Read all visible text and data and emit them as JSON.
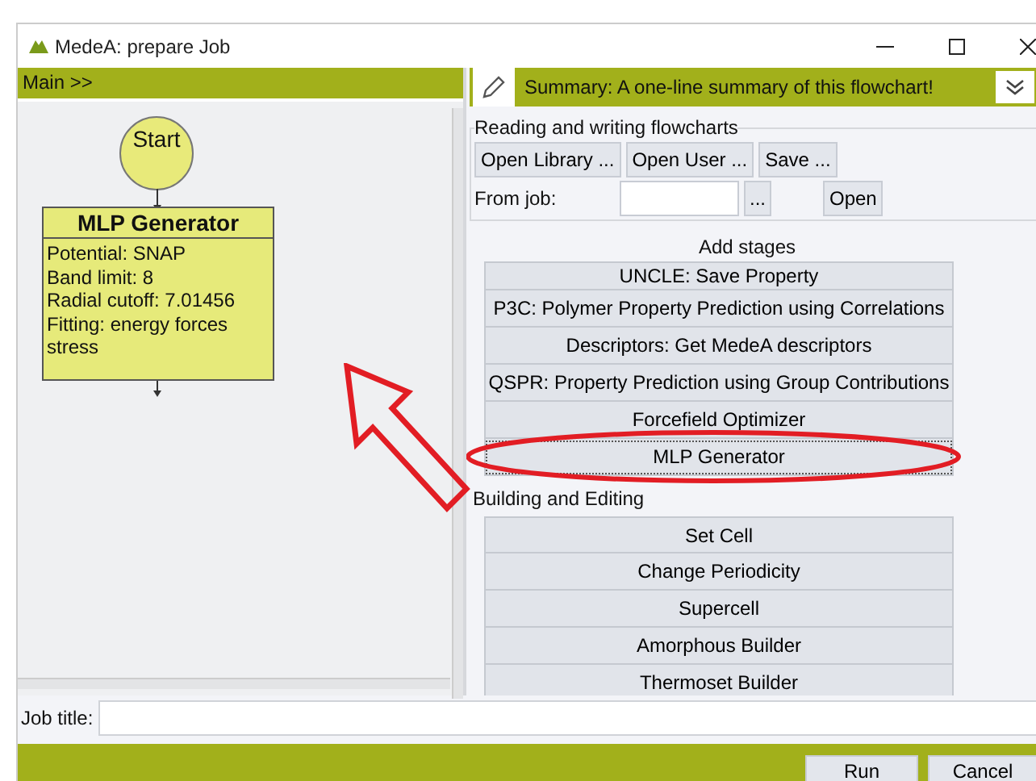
{
  "window": {
    "title": "MedeA: prepare Job"
  },
  "left_panel": {
    "header": "Main >>",
    "flowchart": {
      "start": "Start",
      "stage": {
        "title": "MLP Generator",
        "lines": [
          "Potential: SNAP",
          "Band limit: 8",
          "Radial cutoff: 7.01456",
          "Fitting: energy forces stress"
        ]
      }
    }
  },
  "summary": "Summary: A one-line summary of this flowchart!",
  "reading_group": {
    "title": "Reading and writing flowcharts",
    "buttons": [
      "Open Library ...",
      "Open User ...",
      "Save ..."
    ],
    "from_job_label": "From job:",
    "browse_button": "...",
    "open_button": "Open"
  },
  "add_stages": {
    "title": "Add stages",
    "items": [
      {
        "label": "UNCLE: Save Property",
        "focused": false
      },
      {
        "label": "P3C: Polymer Property Prediction using Correlations",
        "focused": false
      },
      {
        "label": "Descriptors: Get MedeA descriptors",
        "focused": false
      },
      {
        "label": "QSPR: Property Prediction using Group Contributions",
        "focused": false
      },
      {
        "label": "Forcefield Optimizer",
        "focused": false
      },
      {
        "label": "MLP Generator",
        "focused": true
      }
    ]
  },
  "building": {
    "title": "Building and Editing",
    "items": [
      {
        "label": "Set Cell",
        "focused": false
      },
      {
        "label": "Change Periodicity",
        "focused": false
      },
      {
        "label": "Supercell",
        "focused": false
      },
      {
        "label": "Amorphous Builder",
        "focused": false
      },
      {
        "label": "Thermoset Builder",
        "focused": false
      }
    ]
  },
  "job_title_label": "Job title:",
  "footer_buttons": [
    "Run",
    "Cancel"
  ]
}
